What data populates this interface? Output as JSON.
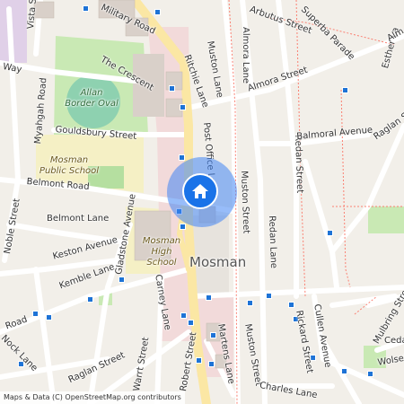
{
  "map": {
    "place": "Mosman",
    "attribution": "Maps & Data (C) OpenStreetMap.org contributors",
    "colors": {
      "background": "#f2efe9",
      "road": "#ffffff",
      "main_road": "#fbe7a4",
      "commercial": "#f2dada",
      "park": "#c9e9b4",
      "school": "#f5f0c5",
      "marker": "#1a73e8",
      "stop": "#1e73d6"
    },
    "marker_icon": "home-icon",
    "streets": [
      "Military Road",
      "Arbutus Street",
      "Superba Parade",
      "Almora Lane",
      "Muston Lane",
      "Vista Street",
      "Way",
      "The Crescent",
      "Ritchie Lane",
      "Almora Street",
      "Myahgah Road",
      "Gouldsbury Street",
      "Post Office Lane",
      "Muston Street",
      "Redan Lane",
      "Redan Street",
      "Balmoral Avenue",
      "Raglan Street",
      "Belmont Road",
      "Belmont Lane",
      "Noble Street",
      "Keston Avenue",
      "Kemble Lane",
      "Gladstone Avenue",
      "Carney Lane",
      "Martens Lane",
      "Muston Street",
      "Cullen Avenue",
      "Mulbring Street",
      "Rickard Street",
      "Road",
      "Nock Lane",
      "Raglan Street",
      "Warrt Street",
      "Robert Street",
      "Charles Lane",
      "Wolseley",
      "Cedar",
      "Esther La",
      "Alm"
    ],
    "areas": {
      "park": "Allan Border Oval",
      "school1": "Mosman Public School",
      "school2": "Mosman High School"
    }
  }
}
